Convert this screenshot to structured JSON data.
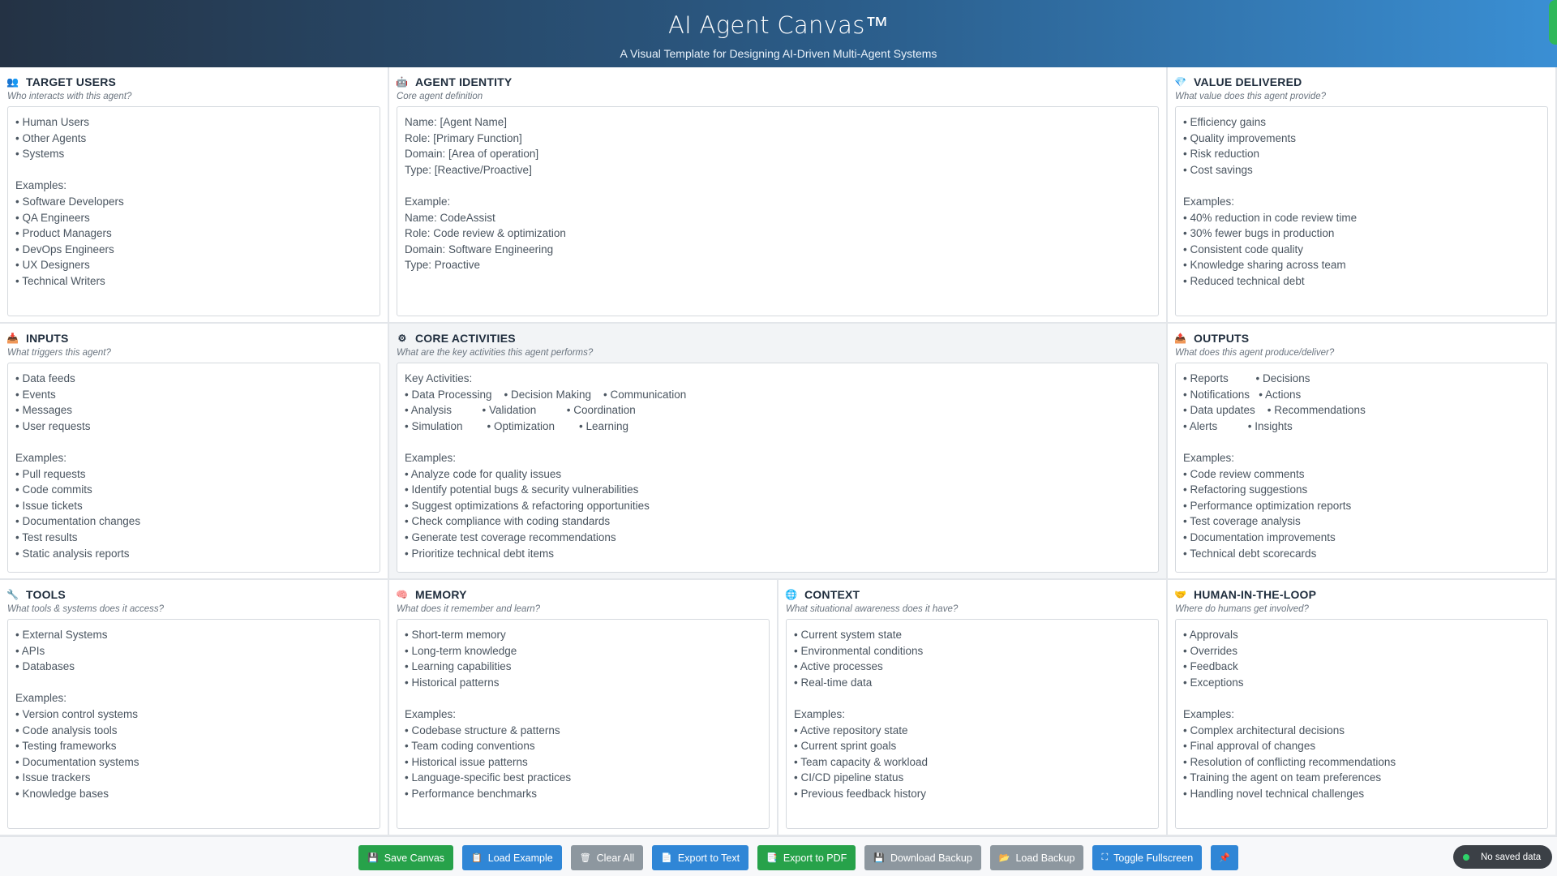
{
  "header": {
    "title": "AI Agent Canvas™",
    "subtitle": "A Visual Template for Designing AI-Driven Multi-Agent Systems"
  },
  "sections": {
    "target_users": {
      "title": "TARGET USERS",
      "icon": "users-icon",
      "question": "Who interacts with this agent?",
      "content": "• Human Users\n• Other Agents\n• Systems\n\nExamples:\n• Software Developers\n• QA Engineers\n• Product Managers\n• DevOps Engineers\n• UX Designers\n• Technical Writers"
    },
    "agent_identity": {
      "title": "AGENT IDENTITY",
      "icon": "robot-icon",
      "question": "Core agent definition",
      "content": "Name: [Agent Name]\nRole: [Primary Function]\nDomain: [Area of operation]\nType: [Reactive/Proactive]\n\nExample:\nName: CodeAssist\nRole: Code review & optimization\nDomain: Software Engineering\nType: Proactive"
    },
    "value_delivered": {
      "title": "VALUE DELIVERED",
      "icon": "gem-icon",
      "question": "What value does this agent provide?",
      "content": "• Efficiency gains\n• Quality improvements\n• Risk reduction\n• Cost savings\n\nExamples:\n• 40% reduction in code review time\n• 30% fewer bugs in production\n• Consistent code quality\n• Knowledge sharing across team\n• Reduced technical debt"
    },
    "inputs": {
      "title": "INPUTS",
      "icon": "inbox-icon",
      "question": "What triggers this agent?",
      "content": "• Data feeds\n• Events\n• Messages\n• User requests\n\nExamples:\n• Pull requests\n• Code commits\n• Issue tickets\n• Documentation changes\n• Test results\n• Static analysis reports"
    },
    "core_activities": {
      "title": "CORE ACTIVITIES",
      "icon": "gear-icon",
      "question": "What are the key activities this agent performs?",
      "content": "Key Activities:\n• Data Processing    • Decision Making    • Communication\n• Analysis          • Validation          • Coordination\n• Simulation        • Optimization        • Learning\n\nExamples:\n• Analyze code for quality issues\n• Identify potential bugs & security vulnerabilities\n• Suggest optimizations & refactoring opportunities\n• Check compliance with coding standards\n• Generate test coverage recommendations\n• Prioritize technical debt items"
    },
    "outputs": {
      "title": "OUTPUTS",
      "icon": "outbox-icon",
      "question": "What does this agent produce/deliver?",
      "content": "• Reports         • Decisions\n• Notifications   • Actions\n• Data updates    • Recommendations\n• Alerts          • Insights\n\nExamples:\n• Code review comments\n• Refactoring suggestions\n• Performance optimization reports\n• Test coverage analysis\n• Documentation improvements\n• Technical debt scorecards"
    },
    "tools": {
      "title": "TOOLS",
      "icon": "wrench-icon",
      "question": "What tools & systems does it access?",
      "content": "• External Systems\n• APIs\n• Databases\n\nExamples:\n• Version control systems\n• Code analysis tools\n• Testing frameworks\n• Documentation systems\n• Issue trackers\n• Knowledge bases"
    },
    "memory": {
      "title": "MEMORY",
      "icon": "brain-icon",
      "question": "What does it remember and learn?",
      "content": "• Short-term memory\n• Long-term knowledge\n• Learning capabilities\n• Historical patterns\n\nExamples:\n• Codebase structure & patterns\n• Team coding conventions\n• Historical issue patterns\n• Language-specific best practices\n• Performance benchmarks"
    },
    "context": {
      "title": "CONTEXT",
      "icon": "globe-icon",
      "question": "What situational awareness does it have?",
      "content": "• Current system state\n• Environmental conditions\n• Active processes\n• Real-time data\n\nExamples:\n• Active repository state\n• Current sprint goals\n• Team capacity & workload\n• CI/CD pipeline status\n• Previous feedback history"
    },
    "human_in_the_loop": {
      "title": "HUMAN-IN-THE-LOOP",
      "icon": "handshake-icon",
      "question": "Where do humans get involved?",
      "content": "• Approvals\n• Overrides\n• Feedback\n• Exceptions\n\nExamples:\n• Complex architectural decisions\n• Final approval of changes\n• Resolution of conflicting recommendations\n• Training the agent on team preferences\n• Handling novel technical challenges"
    }
  },
  "footer": {
    "buttons": [
      {
        "label": "Save Canvas",
        "icon": "save-icon",
        "color": "#27a24a"
      },
      {
        "label": "Load Example",
        "icon": "document-icon",
        "color": "#2f86d6"
      },
      {
        "label": "Clear All",
        "icon": "trash-icon",
        "color": "#8d979f"
      },
      {
        "label": "Export to Text",
        "icon": "document-icon",
        "color": "#2f86d6"
      },
      {
        "label": "Export to PDF",
        "icon": "document-icon",
        "color": "#27a24a"
      },
      {
        "label": "Download Backup",
        "icon": "save-icon",
        "color": "#8d979f"
      },
      {
        "label": "Load Backup",
        "icon": "folder-icon",
        "color": "#8d979f"
      },
      {
        "label": "Toggle Fullscreen",
        "icon": "fullscreen-icon",
        "color": "#2f86d6"
      },
      {
        "label": "",
        "icon": "pin-icon",
        "color": "#2f86d6"
      }
    ],
    "status": "No saved data"
  },
  "colors": {
    "header_start": "#243244",
    "header_end": "#3a8fd4",
    "accent_green": "#27a24a",
    "accent_blue": "#2f86d6",
    "neutral_gray": "#8d979f"
  }
}
